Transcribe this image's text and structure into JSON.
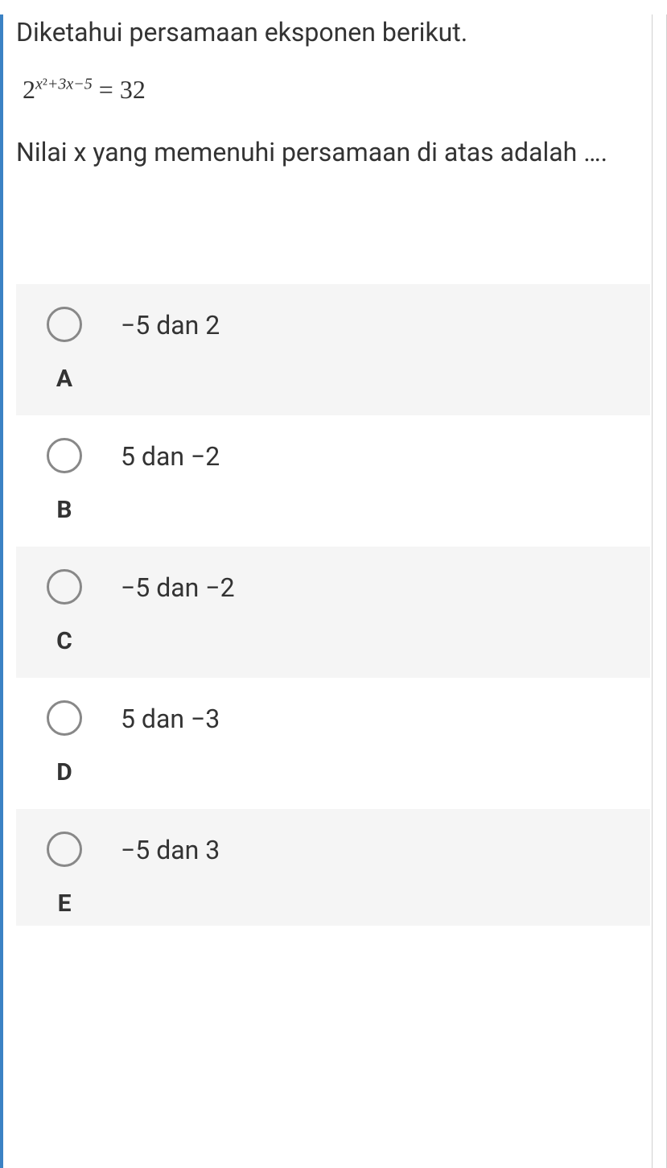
{
  "question": {
    "intro": "Diketahui persamaan eksponen berikut.",
    "equation_base": "2",
    "equation_exponent": "x²+3x−5",
    "equation_rhs": "= 32",
    "prompt": "Nilai x yang memenuhi persamaan di atas adalah …."
  },
  "options": [
    {
      "letter": "A",
      "text": "−5 dan 2"
    },
    {
      "letter": "B",
      "text": "5 dan −2"
    },
    {
      "letter": "C",
      "text": "−5 dan −2"
    },
    {
      "letter": "D",
      "text": "5 dan −3"
    },
    {
      "letter": "E",
      "text": "−5 dan 3"
    }
  ]
}
